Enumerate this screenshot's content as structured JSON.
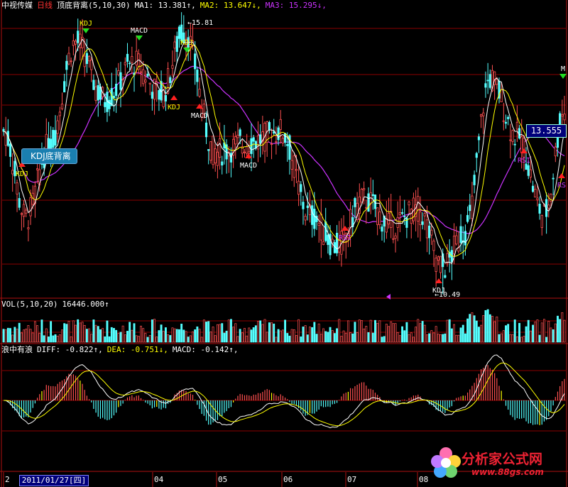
{
  "header": {
    "stock_name": "中视传媒",
    "period": "日线",
    "indicator": "顶底背离",
    "indicator_params": "(5,10,30)",
    "ma1": "MA1: 13.381↑,",
    "ma2": "MA2: 13.647↓,",
    "ma3": "MA3: 15.295↓,"
  },
  "vol_header": {
    "label": "VOL(5,10,20)",
    "value": "16446.000↑"
  },
  "macd_header": {
    "name": "浪中有浪",
    "diff": "DIFF: -0.822↑,",
    "dea": "DEA: -0.751↓,",
    "macd": "MACD: -0.142↑,"
  },
  "x_axis": {
    "date_box": "2011/01/27[四]",
    "month_labels": [
      {
        "text": "2"
      },
      {
        "text": "04"
      },
      {
        "text": "05"
      },
      {
        "text": "06"
      },
      {
        "text": "07"
      },
      {
        "text": "08"
      }
    ]
  },
  "annotations": {
    "kdj_callout": "KDJ底背离",
    "price_tag": "13.555",
    "high_label": "15.81",
    "low_label": "10.49",
    "top_signals": [
      {
        "text": "KDJ",
        "color": "#ffff00",
        "arrow": "down"
      },
      {
        "text": "MACD",
        "color": "#ffffff",
        "arrow": "down"
      },
      {
        "text": "KDJ",
        "color": "#ffff00",
        "arrow": "down"
      },
      {
        "text": "M",
        "color": "#ffffff",
        "arrow": "down"
      }
    ],
    "bottom_signals": [
      {
        "text": "KDJ",
        "color": "#ffff00"
      },
      {
        "text": "KDJ",
        "color": "#ffff00"
      },
      {
        "text": "MACD",
        "color": "#ffffff"
      },
      {
        "text": "MACD",
        "color": "#ffffff"
      },
      {
        "text": "RSI",
        "color": "#cc33ff"
      },
      {
        "text": "KDJ",
        "color": "#ffffff"
      },
      {
        "text": "RSI",
        "color": "#cc33ff"
      },
      {
        "text": "RS",
        "color": "#cc33ff"
      }
    ]
  },
  "watermark": {
    "main": "分析家公式网",
    "url": "www.88gs.com"
  },
  "chart_data": {
    "type": "candlestick",
    "panels": [
      "price",
      "volume",
      "macd"
    ],
    "colors": {
      "up": "#ff5050",
      "down": "#54ffff",
      "ma1": "#ffffff",
      "ma2": "#ffff00",
      "ma3": "#cc33ff",
      "grid": "#8b0000",
      "macd_pos": "#ff5050",
      "macd_neg": "#54ffff"
    },
    "price_range": [
      10.49,
      15.81
    ],
    "price_anchor_points": [
      {
        "i": 0,
        "p": 13.6
      },
      {
        "i": 10,
        "p": 11.95
      },
      {
        "i": 20,
        "p": 13.3
      },
      {
        "i": 32,
        "p": 15.3
      },
      {
        "i": 45,
        "p": 14.2
      },
      {
        "i": 58,
        "p": 14.9
      },
      {
        "i": 70,
        "p": 14.3
      },
      {
        "i": 80,
        "p": 15.5
      },
      {
        "i": 94,
        "p": 13.2
      },
      {
        "i": 110,
        "p": 13.4
      },
      {
        "i": 123,
        "p": 13.6
      },
      {
        "i": 136,
        "p": 12.0
      },
      {
        "i": 148,
        "p": 11.4
      },
      {
        "i": 160,
        "p": 12.3
      },
      {
        "i": 172,
        "p": 11.8
      },
      {
        "i": 184,
        "p": 12.1
      },
      {
        "i": 195,
        "p": 11.0
      },
      {
        "i": 205,
        "p": 11.7
      },
      {
        "i": 216,
        "p": 14.6
      },
      {
        "i": 228,
        "p": 13.5
      },
      {
        "i": 240,
        "p": 12.0
      },
      {
        "i": 249,
        "p": 14.0
      }
    ],
    "notes": {
      "ma_params": [
        5,
        10,
        30
      ],
      "vol_params": [
        5,
        10,
        20
      ]
    }
  }
}
